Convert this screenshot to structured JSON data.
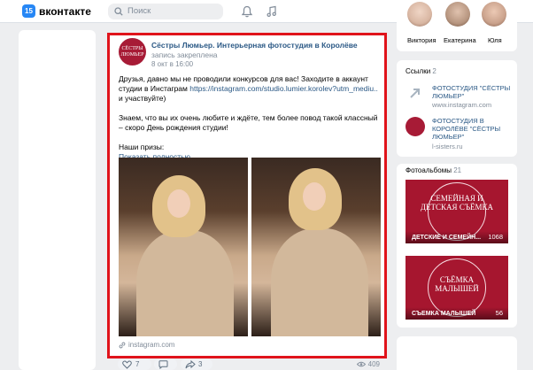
{
  "header": {
    "logo_badge": "15",
    "logo_text": "вконтакте",
    "search_placeholder": "Поиск"
  },
  "post": {
    "avatar_text": "СЁСТРЫ ЛЮМЬЕР",
    "author": "Сёстры Люмьер. Интерьерная фотостудия в Королёве",
    "status": "запись закреплена",
    "date": "8 окт в 16:00",
    "text_line1": "Друзья, давно мы не проводили конкурсов для вас! Заходите в аккаунт студии в Инстаграм ",
    "text_link": "https://instagram.com/studio.lumier.korolev?utm_mediu..",
    "text_line1_end": " и участвуйте)",
    "text_para2": "Знаем, что вы их очень любите и ждёте, тем более повод такой классный – скоро День рождения студии!",
    "text_para3": "Наши призы:",
    "show_more": "Показать полностью...",
    "source": "instagram.com",
    "likes": "7",
    "reposts": "3",
    "views": "409"
  },
  "friends": [
    {
      "name": "Виктория",
      "color": "#d9b7a3"
    },
    {
      "name": "Екатерина",
      "color": "#b79680"
    },
    {
      "name": "Юля",
      "color": "#caa28c"
    }
  ],
  "links": {
    "title": "Ссылки",
    "count": "2",
    "items": [
      {
        "title": "ФОТОСТУДИЯ \"СЁСТРЫ ЛЮМЬЕР\"",
        "url": "www.instagram.com"
      },
      {
        "title": "ФОТОСТУДИЯ В КОРОЛЁВЕ \"СЁСТРЫ ЛЮМЬЕР\"",
        "url": "l-sisters.ru"
      }
    ]
  },
  "albums": {
    "title": "Фотоальбомы",
    "count": "21",
    "items": [
      {
        "cover": "СЕМЕЙНАЯ И ДЕТСКАЯ СЪЁМКА",
        "caption": "ДЕТСКИЕ И СЕМЕЙН...",
        "count": "1068"
      },
      {
        "cover": "СЪЁМКА МАЛЫШЕЙ",
        "caption": "СЪЕМКА МАЛЫШЕЙ",
        "count": "56"
      }
    ]
  }
}
